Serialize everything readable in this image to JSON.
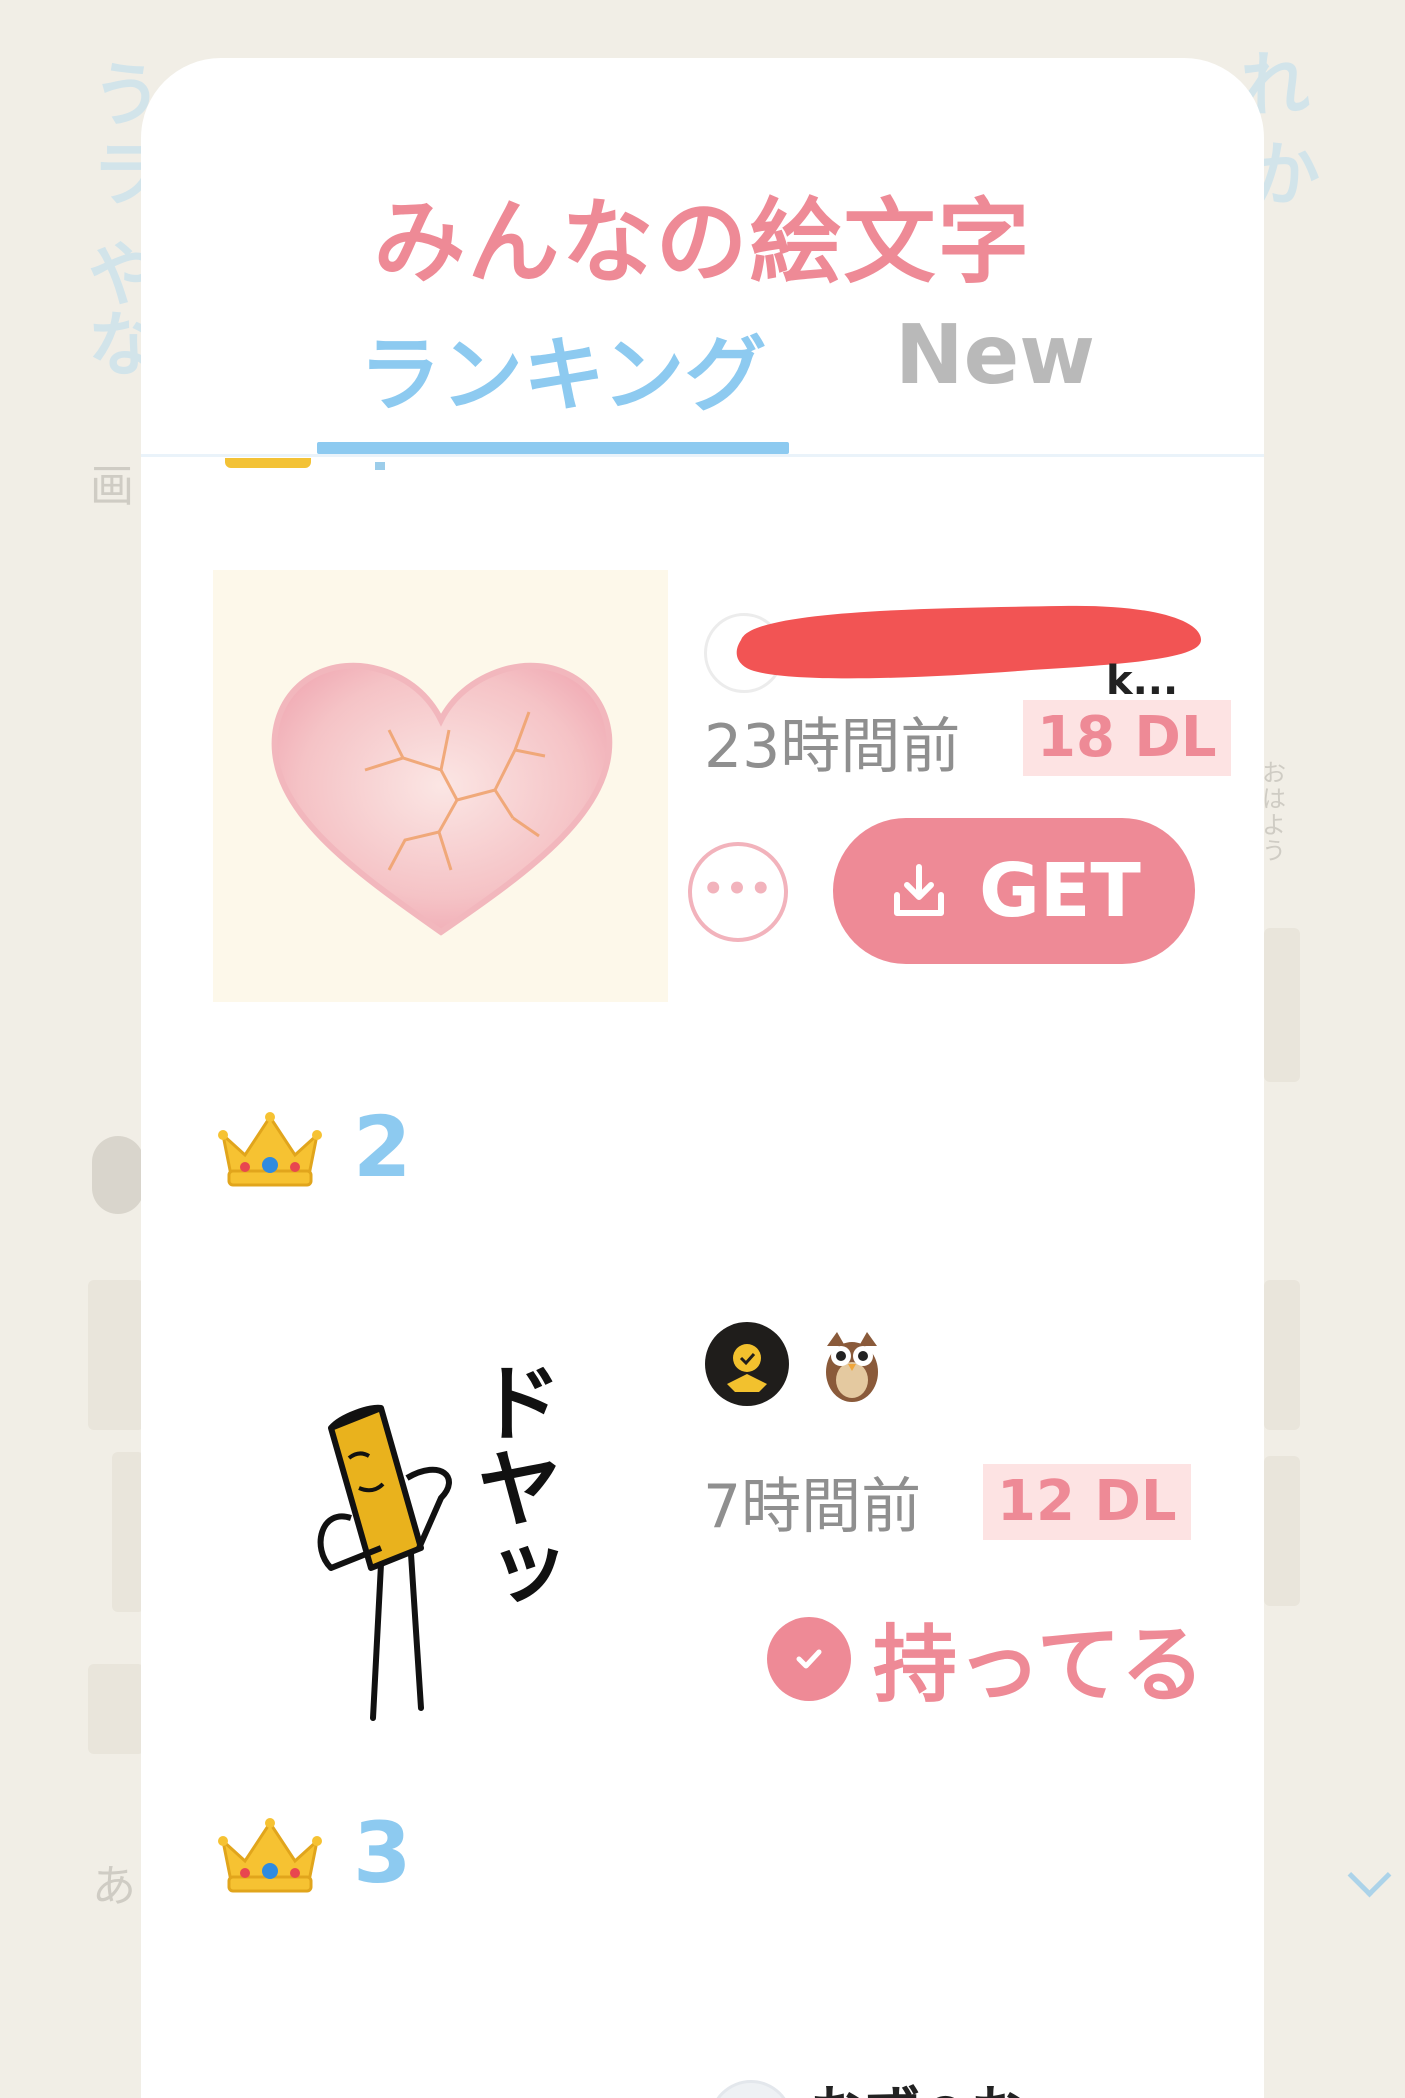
{
  "background": {
    "left_glyphs": [
      "う",
      "ラ",
      "や",
      "な"
    ],
    "right_glyphs": [
      "れ",
      "か"
    ],
    "left_labels": [
      "画",
      "あ"
    ],
    "right_vertical_text": "おはよう"
  },
  "sheet": {
    "title": "みんなの絵文字",
    "tabs": [
      {
        "label": "ランキング",
        "active": true
      },
      {
        "label": "New",
        "active": false
      }
    ]
  },
  "items": [
    {
      "image": "cracked-heart",
      "author": "k...",
      "author_redacted": true,
      "time": "23時間前",
      "downloads": "18 DL",
      "more_icon": "ellipsis-icon",
      "action": "GET"
    },
    {
      "rank": "2",
      "image": "fry-character-doya",
      "image_text": "ドヤッ",
      "author_badge": "owl",
      "time": "7時間前",
      "downloads": "12 DL",
      "status": "持ってる"
    },
    {
      "rank": "3",
      "author": "おず○おー"
    }
  ],
  "colors": {
    "accent_pink": "#ee8a96",
    "accent_blue": "#8dcaf0",
    "dl_bg": "#fde3e3",
    "redaction": "#f25454"
  }
}
